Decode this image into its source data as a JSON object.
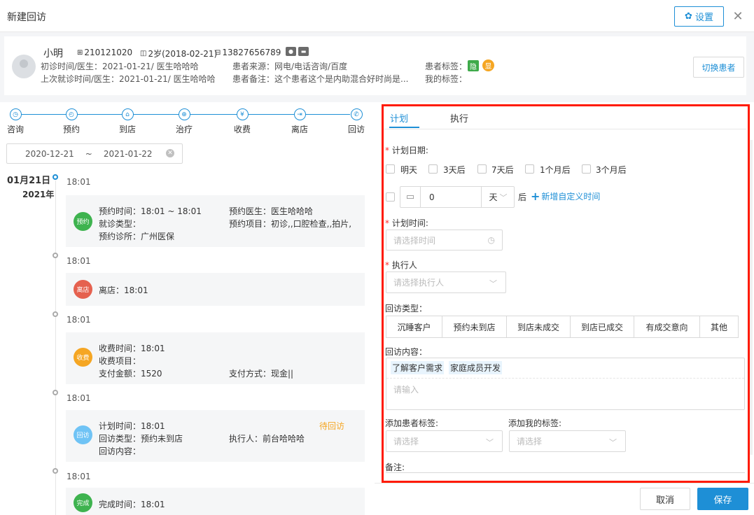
{
  "header": {
    "title": "新建回访",
    "settings_label": "设置",
    "close_label": "✕"
  },
  "patient": {
    "name": "小明",
    "id": "210121020",
    "age": "2岁(2018-02-21)",
    "phone": "13827656789",
    "first_visit": "初诊时间/医生：2021-01-21/ 医生哈哈哈",
    "last_visit": "上次就诊时间/医生：2021-01-21/ 医生哈哈哈",
    "source": "患者来源：网电/电话咨询/百度",
    "note": "患者备注：这个患者这个是内助混合好时尚是...",
    "tags_label": "患者标签：",
    "tag_green": "隐",
    "tag_orange": "显",
    "my_tags_label": "我的标签：",
    "switch_label": "切换患者"
  },
  "steps": [
    "咨询",
    "预约",
    "到店",
    "治疗",
    "收费",
    "离店",
    "回访"
  ],
  "date_range": {
    "start": "2020-12-21",
    "sep": "~",
    "end": "2021-01-22"
  },
  "timeline": {
    "date": "01月21日",
    "year": "2021年",
    "items": [
      {
        "time": "18:01",
        "badge": "预约",
        "badge_color": "#3eb34f",
        "lines": [
          "预约时间：18:01 ~ 18:01",
          "就诊类型：",
          "预约诊所：广州医保"
        ],
        "right_lines": [
          "预约医生：医生哈哈哈",
          "预约项目：初诊,,口腔检查,,拍片,"
        ]
      },
      {
        "time": "18:01",
        "badge": "离店",
        "badge_color": "#e5614f",
        "lines": [
          "离店：18:01"
        ]
      },
      {
        "time": "18:01",
        "badge": "收费",
        "badge_color": "#f5a623",
        "lines": [
          "收费时间：18:01",
          "收费项目：",
          "支付金额：1520"
        ],
        "pay_method": "支付方式：现金||"
      },
      {
        "time": "18:01",
        "badge": "回访",
        "badge_color": "#6fc3f5",
        "lines": [
          "计划时间：18:01",
          "回访类型：预约未到店",
          "回访内容："
        ],
        "executor": "执行人：前台哈哈哈",
        "status": "待回访"
      },
      {
        "time": "18:01",
        "badge": "完成",
        "badge_color": "#3eb34f",
        "lines": [
          "完成时间：18:01"
        ]
      }
    ]
  },
  "form": {
    "tabs": [
      "计划",
      "执行"
    ],
    "plan_date_label": "计划日期:",
    "quick_dates": [
      "明天",
      "3天后",
      "7天后",
      "1个月后",
      "3个月后"
    ],
    "custom_value": "0",
    "custom_unit": "天",
    "after_label": "后",
    "add_custom_label": "新增自定义时间",
    "plan_time_label": "计划时间:",
    "plan_time_placeholder": "请选择时间",
    "executor_label": "执行人",
    "executor_placeholder": "请选择执行人",
    "visit_type_label": "回访类型：",
    "visit_types": [
      "沉睡客户",
      "预约未到店",
      "到店未成交",
      "到店已成交",
      "有成交意向",
      "其他"
    ],
    "content_label": "回访内容：",
    "content_chips": [
      "了解客户需求",
      "家庭成员开发"
    ],
    "content_placeholder": "请输入",
    "patient_tag_label": "添加患者标签:",
    "my_tag_label": "添加我的标签:",
    "select_placeholder": "请选择",
    "remark_label": "备注:"
  },
  "footer": {
    "cancel_label": "取消",
    "save_label": "保存"
  },
  "colors": {
    "accent": "#1e8fd6",
    "highlight_border": "#ff1a00",
    "required": "#ff2a2a",
    "pending_status": "#f5a623"
  }
}
